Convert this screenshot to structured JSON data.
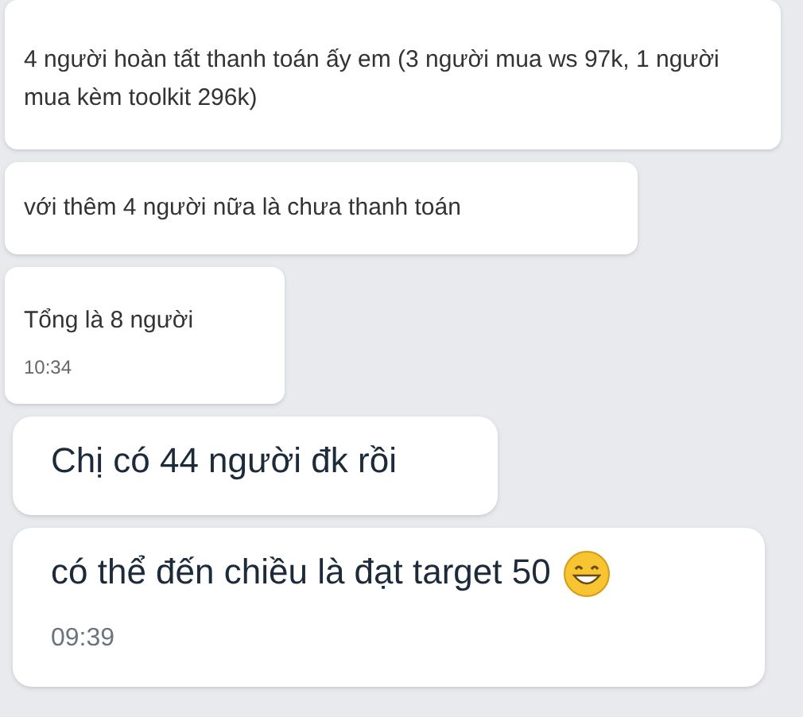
{
  "messages": [
    {
      "kind": "normal",
      "text": "4 người hoàn tất thanh toán ấy em (3 người mua ws 97k, 1 người mua kèm toolkit 296k)",
      "has_emoji": false
    },
    {
      "kind": "normal",
      "text": "với thêm 4 người nữa là chưa thanh toán",
      "has_emoji": false
    },
    {
      "kind": "normal",
      "text": "Tổng là 8 người",
      "time": "10:34",
      "has_emoji": false
    },
    {
      "kind": "large",
      "text": "Chị có 44 người đk rồi",
      "has_emoji": false
    },
    {
      "kind": "large",
      "text": "có thể đến chiều là đạt target 50",
      "time": "09:39",
      "has_emoji": true
    }
  ]
}
